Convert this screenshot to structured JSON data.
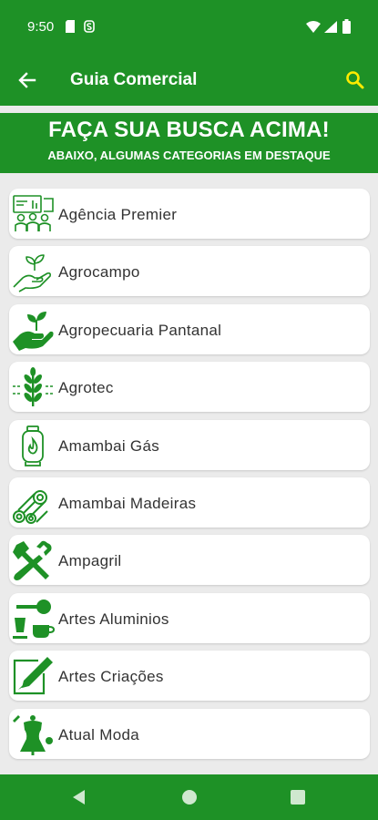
{
  "status_bar": {
    "time": "9:50",
    "icons": [
      "sim-card-icon",
      "s-notification-icon",
      "wifi-icon",
      "signal-icon",
      "battery-icon"
    ]
  },
  "app_bar": {
    "title": "Guia Comercial",
    "back_icon": "arrow-left-icon",
    "search_icon": "search-icon"
  },
  "banner": {
    "title": "FAÇA SUA BUSCA ACIMA!",
    "subtitle": "ABAIXO, ALGUMAS CATEGORIAS EM DESTAQUE"
  },
  "categories": [
    {
      "label": "Agência Premier",
      "icon": "team-presentation-icon"
    },
    {
      "label": "Agrocampo",
      "icon": "hand-sprout-icon"
    },
    {
      "label": "Agropecuaria Pantanal",
      "icon": "hand-plant-icon"
    },
    {
      "label": "Agrotec",
      "icon": "wheat-icon"
    },
    {
      "label": "Amambai Gás",
      "icon": "gas-cylinder-icon"
    },
    {
      "label": "Amambai Madeiras",
      "icon": "wood-logs-icon"
    },
    {
      "label": "Ampagril",
      "icon": "tools-icon"
    },
    {
      "label": "Artes Aluminios",
      "icon": "aluminium-tools-icon"
    },
    {
      "label": "Artes Criações",
      "icon": "design-pen-icon"
    },
    {
      "label": "Atual Moda",
      "icon": "fashion-mannequin-icon"
    }
  ],
  "nav_bar": {
    "icons": [
      "back-triangle-icon",
      "home-circle-icon",
      "recents-square-icon"
    ]
  },
  "colors": {
    "primary": "#1e9126",
    "accent": "#ffeb00",
    "background": "#ebebeb",
    "card": "#ffffff",
    "text": "#333333"
  }
}
